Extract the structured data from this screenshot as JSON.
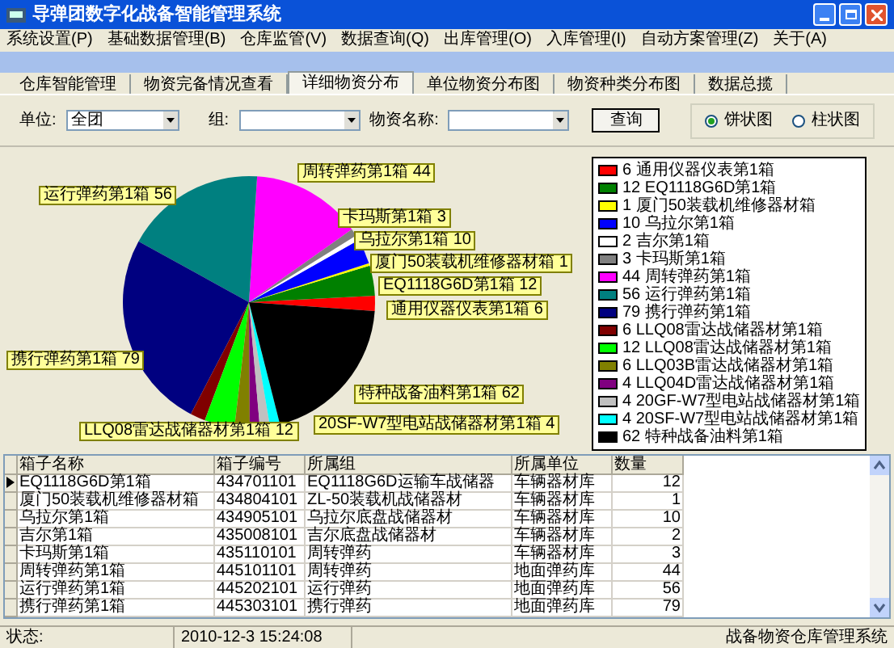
{
  "window": {
    "title": "导弹团数字化战备智能管理系统"
  },
  "menu": [
    "系统设置(P)",
    "基础数据管理(B)",
    "仓库监管(V)",
    "数据查询(Q)",
    "出库管理(O)",
    "入库管理(I)",
    "自动方案管理(Z)",
    "关于(A)"
  ],
  "tabs": [
    {
      "label": "仓库智能管理",
      "selected": false
    },
    {
      "label": "物资完备情况查看",
      "selected": false
    },
    {
      "label": "详细物资分布",
      "selected": true
    },
    {
      "label": "单位物资分布图",
      "selected": false
    },
    {
      "label": "物资种类分布图",
      "selected": false
    },
    {
      "label": "数据总揽",
      "selected": false
    }
  ],
  "filters": {
    "unit": {
      "label": "单位:",
      "value": "全团"
    },
    "group": {
      "label": "组:"
    },
    "item": {
      "label": "物资名称:"
    },
    "query_button": "查询",
    "chart_types": [
      {
        "label": "饼状图",
        "selected": true
      },
      {
        "label": "柱状图",
        "selected": false
      }
    ]
  },
  "chart": {
    "chart_data": {
      "type": "pie",
      "categories": [
        "6 通用仪器仪表第1箱",
        "12 EQ1118G6D第1箱",
        "1 厦门50装载机维修器材箱",
        "10 乌拉尔第1箱",
        "2 吉尔第1箱",
        "3 卡玛斯第1箱",
        "44 周转弹药第1箱",
        "56 运行弹药第1箱",
        "79 携行弹药第1箱",
        "6 LLQ08雷达战储器材第1箱",
        "12 LLQ08雷达战储器材第1箱",
        "6 LLQ03B雷达战储器材第1箱",
        "4 LLQ04D雷达战储器材第1箱",
        "4 20GF-W7型电站战储器材第1箱",
        "4 20SF-W7型电站战储器材第1箱",
        "62 特种战备油料第1箱"
      ],
      "values": [
        6,
        12,
        1,
        10,
        2,
        3,
        44,
        56,
        79,
        6,
        12,
        6,
        4,
        4,
        4,
        62
      ],
      "colors": [
        "#ff0000",
        "#008000",
        "#ffff00",
        "#0000ff",
        "#ffffff",
        "#808080",
        "#ff00ff",
        "#008080",
        "#000080",
        "#800000",
        "#00ff00",
        "#808000",
        "#800080",
        "#c0c0c0",
        "#00ffff",
        "#000000"
      ],
      "legend": "right",
      "annotations": [
        "周转弹药第1箱 44",
        "运行弹药第1箱 56",
        "卡玛斯第1箱 3",
        "乌拉尔第1箱 10",
        "厦门50装载机维修器材箱 1",
        "EQ1118G6D第1箱 12",
        "通用仪器仪表第1箱 6",
        "特种战备油料第1箱 62",
        "携行弹药第1箱 79",
        "LLQ08雷达战储器材第1箱 12",
        "20SF-W7型电站战储器材第1箱 4"
      ]
    }
  },
  "table": {
    "columns": [
      "箱子名称",
      "箱子编号",
      "所属组",
      "所属单位",
      "数量"
    ],
    "rows": [
      {
        "cells": [
          "EQ1118G6D第1箱",
          "434701101",
          "EQ1118G6D运输车战储器",
          "车辆器材库",
          "12"
        ],
        "selected": true
      },
      {
        "cells": [
          "厦门50装载机维修器材箱",
          "434804101",
          "ZL-50装载机战储器材",
          "车辆器材库",
          "1"
        ],
        "selected": false
      },
      {
        "cells": [
          "乌拉尔第1箱",
          "434905101",
          "乌拉尔底盘战储器材",
          "车辆器材库",
          "10"
        ],
        "selected": false
      },
      {
        "cells": [
          "吉尔第1箱",
          "435008101",
          "吉尔底盘战储器材",
          "车辆器材库",
          "2"
        ],
        "selected": false
      },
      {
        "cells": [
          "卡玛斯第1箱",
          "435110101",
          "周转弹药",
          "车辆器材库",
          "3"
        ],
        "selected": false
      },
      {
        "cells": [
          "周转弹药第1箱",
          "445101101",
          "周转弹药",
          "地面弹药库",
          "44"
        ],
        "selected": false
      },
      {
        "cells": [
          "运行弹药第1箱",
          "445202101",
          "运行弹药",
          "地面弹药库",
          "56"
        ],
        "selected": false
      },
      {
        "cells": [
          "携行弹药第1箱",
          "445303101",
          "携行弹药",
          "地面弹药库",
          "79"
        ],
        "selected": false
      }
    ]
  },
  "status_bar": {
    "label": "状态:",
    "time": "2010-12-3 15:24:08",
    "app": "战备物资仓库管理系统"
  }
}
